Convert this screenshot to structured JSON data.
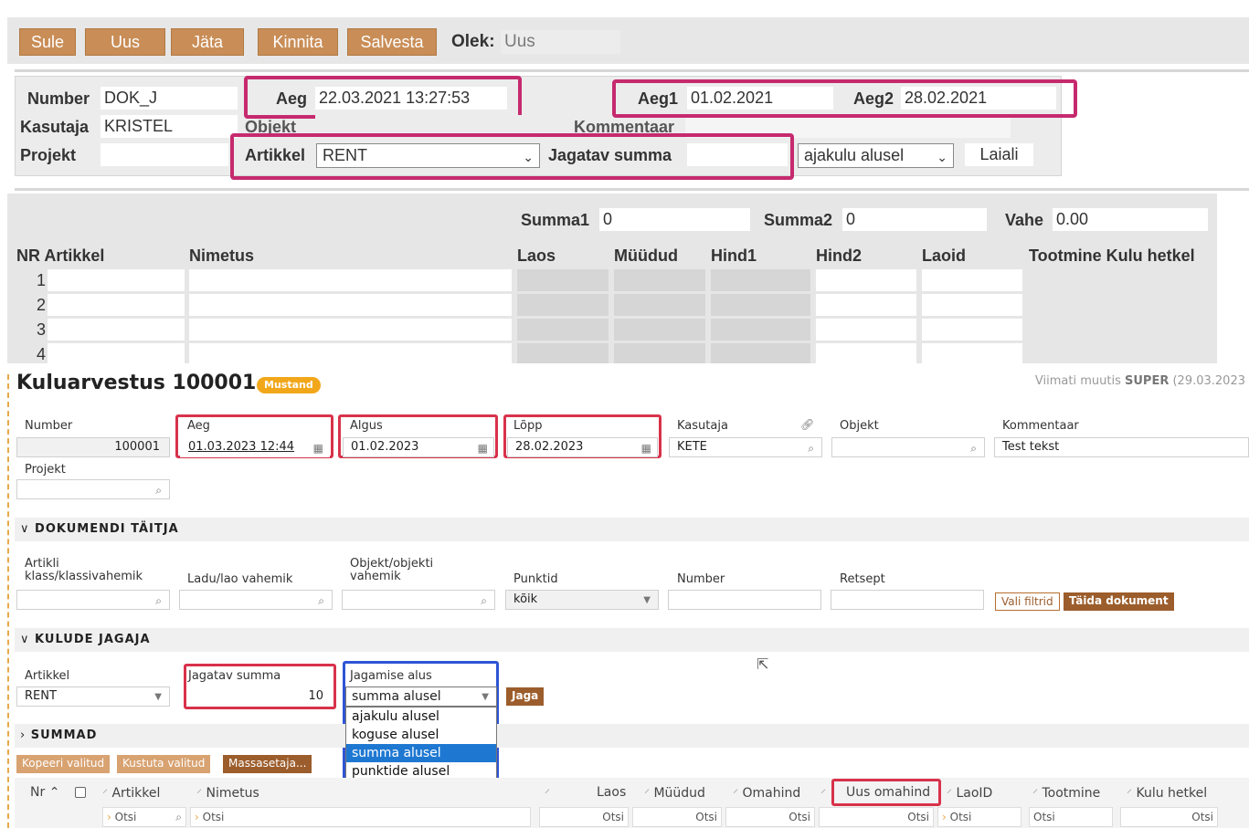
{
  "old": {
    "buttons": [
      "Sule",
      "Uus",
      "Jäta",
      "Kinnita",
      "Salvesta"
    ],
    "olek_label": "Olek:",
    "olek_value": "Uus",
    "number_label": "Number",
    "number_value": "DOK_J",
    "aeg_label": "Aeg",
    "aeg_value": "22.03.2021 13:27:53",
    "aeg1_label": "Aeg1",
    "aeg1_value": "01.02.2021",
    "aeg2_label": "Aeg2",
    "aeg2_value": "28.02.2021",
    "kasutaja_label": "Kasutaja",
    "kasutaja_value": "KRISTEL",
    "objekt_label": "Objekt",
    "kommentaar_label": "Kommentaar",
    "projekt_label": "Projekt",
    "artikkel_label": "Artikkel",
    "artikkel_value": "RENT",
    "jagatav_label": "Jagatav summa",
    "basis_value": "ajakulu alusel",
    "laiali_button": "Laiali",
    "summa1_label": "Summa1",
    "summa1_value": "0",
    "summa2_label": "Summa2",
    "summa2_value": "0",
    "vahe_label": "Vahe",
    "vahe_value": "0.00",
    "columns": {
      "nr_artikkel": "NR Artikkel",
      "nimetus": "Nimetus",
      "laos": "Laos",
      "muudud": "Müüdud",
      "hind1": "Hind1",
      "hind2": "Hind2",
      "laoid": "Laoid",
      "tootmine": "Tootmine Kulu hetkel"
    },
    "rows": [
      "1",
      "2",
      "3",
      "4"
    ]
  },
  "new": {
    "title": "Kuluarvestus 100001",
    "badge": "Mustand",
    "modified_prefix": "Viimati muutis",
    "modified_user": "SUPER",
    "modified_date": "(29.03.2023",
    "fields": {
      "number_label": "Number",
      "number_value": "100001",
      "aeg_label": "Aeg",
      "aeg_value": "01.03.2023 12:44",
      "algus_label": "Algus",
      "algus_value": "01.02.2023",
      "lopp_label": "Lõpp",
      "lopp_value": "28.02.2023",
      "kasutaja_label": "Kasutaja",
      "kasutaja_value": "KETE",
      "objekt_label": "Objekt",
      "kommentaar_label": "Kommentaar",
      "kommentaar_value": "Test tekst",
      "projekt_label": "Projekt"
    },
    "section_taitja": "DOKUMENDI TÄITJA",
    "taitja": {
      "artikli_klass_l1": "Artikli",
      "artikli_klass_l2": "klass/klassivahemik",
      "ladu_label": "Ladu/lao vahemik",
      "objekt_l1": "Objekt/objekti",
      "objekt_l2": "vahemik",
      "punktid_label": "Punktid",
      "punktid_value": "kõik",
      "number_label": "Number",
      "retsept_label": "Retsept",
      "vali_filtrid": "Vali filtrid",
      "taida_dokument": "Täida dokument"
    },
    "section_jagaja": "KULUDE JAGAJA",
    "jagaja": {
      "artikkel_label": "Artikkel",
      "artikkel_value": "RENT",
      "jagatav_label": "Jagatav summa",
      "jagatav_value": "10",
      "alus_label": "Jagamise alus",
      "alus_value": "summa alusel",
      "jaga_button": "Jaga",
      "options": [
        "ajakulu alusel",
        "koguse alusel",
        "summa alusel",
        "punktide alusel"
      ]
    },
    "section_summad": "SUMMAD",
    "grid_buttons": [
      "Kopeeri valitud",
      "Kustuta valitud",
      "Massasetaja..."
    ],
    "grid_headers": {
      "nr": "Nr",
      "artikkel": "Artikkel",
      "nimetus": "Nimetus",
      "laos": "Laos",
      "muudud": "Müüdud",
      "omahind": "Omahind",
      "uus_omahind": "Uus omahind",
      "laoid": "LaoID",
      "tootmine": "Tootmine",
      "kulu_hetkel": "Kulu hetkel"
    },
    "filter_placeholder": "Otsi"
  }
}
